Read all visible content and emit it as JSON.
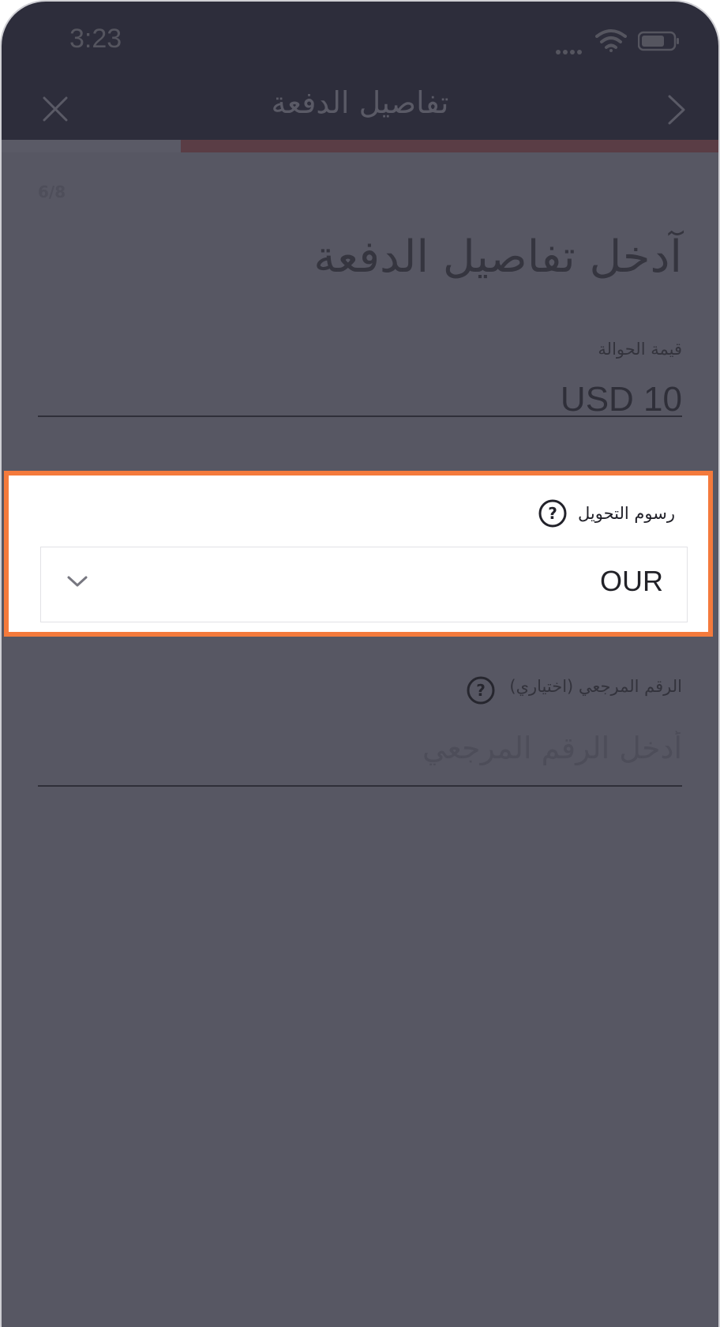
{
  "status_bar": {
    "time": "3:23"
  },
  "header": {
    "title": "تفاصيل الدفعة"
  },
  "progress": {
    "current_step": 6,
    "total_steps": 8,
    "fraction": 0.75
  },
  "step_indicator": "6/8",
  "page": {
    "title": "آدخل تفاصيل الدفعة"
  },
  "amount": {
    "label": "قيمة الحوالة",
    "value": "USD 10"
  },
  "fees": {
    "label": "رسوم التحويل",
    "selected": "OUR"
  },
  "reference": {
    "label": "الرقم المرجعي (اختياري)",
    "placeholder": "أدخل الرقم المرجعي",
    "value": ""
  },
  "colors": {
    "overlay": "#575763",
    "header": "#2d2d3b",
    "highlight": "#f47a3c",
    "progress_fill": "#5a3d45"
  }
}
